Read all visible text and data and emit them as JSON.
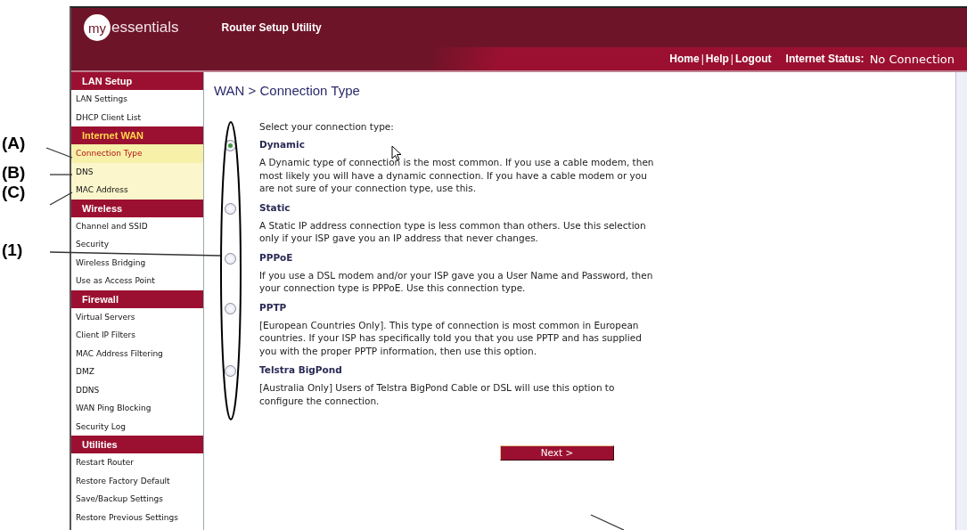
{
  "header": {
    "logo_badge": "my",
    "logo_word": "essentials",
    "app_title": "Router Setup Utility",
    "links": [
      "Home",
      "Help",
      "Logout"
    ],
    "link_separator": "|",
    "status_label": "Internet Status:",
    "status_value": "No Connection"
  },
  "sidebar": [
    {
      "title": "LAN Setup",
      "active": false,
      "items": [
        {
          "label": "LAN Settings",
          "selected": false
        },
        {
          "label": "DHCP Client List",
          "selected": false
        }
      ]
    },
    {
      "title": "Internet WAN",
      "active": true,
      "items": [
        {
          "label": "Connection Type",
          "selected": true
        },
        {
          "label": "DNS",
          "selected": false
        },
        {
          "label": "MAC Address",
          "selected": false
        }
      ]
    },
    {
      "title": "Wireless",
      "active": false,
      "items": [
        {
          "label": "Channel and SSID",
          "selected": false
        },
        {
          "label": "Security",
          "selected": false
        },
        {
          "label": "Wireless Bridging",
          "selected": false
        },
        {
          "label": "Use as Access Point",
          "selected": false
        }
      ]
    },
    {
      "title": "Firewall",
      "active": false,
      "items": [
        {
          "label": "Virtual Servers",
          "selected": false
        },
        {
          "label": "Client IP Filters",
          "selected": false
        },
        {
          "label": "MAC Address Filtering",
          "selected": false
        },
        {
          "label": "DMZ",
          "selected": false
        },
        {
          "label": "DDNS",
          "selected": false
        },
        {
          "label": "WAN Ping Blocking",
          "selected": false
        },
        {
          "label": "Security Log",
          "selected": false
        }
      ]
    },
    {
      "title": "Utilities",
      "active": false,
      "items": [
        {
          "label": "Restart Router",
          "selected": false
        },
        {
          "label": "Restore Factory Default",
          "selected": false
        },
        {
          "label": "Save/Backup Settings",
          "selected": false
        },
        {
          "label": "Restore Previous Settings",
          "selected": false
        }
      ]
    }
  ],
  "page_title": "WAN > Connection Type",
  "prompt": "Select your connection type:",
  "options": [
    {
      "label": "Dynamic",
      "selected": true,
      "description": "A Dynamic type of connection is the most common. If you use a cable modem, then most likely you will have a dynamic connection. If you have a cable modem or you are not sure of your connection type, use this."
    },
    {
      "label": "Static",
      "selected": false,
      "description": "A Static IP address connection type is less common than others. Use this selection only if your ISP gave you an IP address that never changes."
    },
    {
      "label": "PPPoE",
      "selected": false,
      "description": "If you use a DSL modem and/or your ISP gave you a User Name and Password, then your connection type is PPPoE. Use this connection type."
    },
    {
      "label": "PPTP",
      "selected": false,
      "description": "[European Countries Only]. This type of connection is most common in European countries. If your ISP has specifically told you that you use PPTP and has supplied you with the proper PPTP information, then use this option."
    },
    {
      "label": "Telstra BigPond",
      "selected": false,
      "description": "[Australia Only] Users of Telstra BigPond Cable or DSL will use this option to configure the connection."
    }
  ],
  "next_button": "Next >",
  "annotations": [
    "(A)",
    "(B)",
    "(C)",
    "(1)"
  ]
}
